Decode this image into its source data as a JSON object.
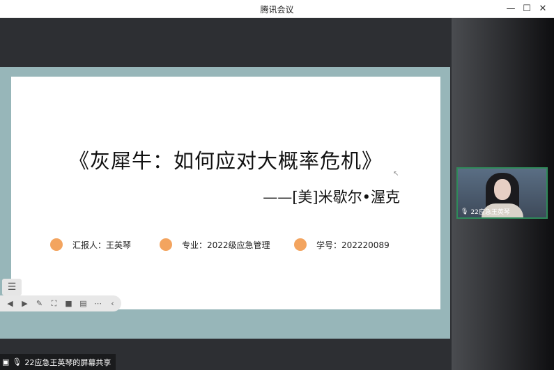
{
  "window": {
    "title": "腾讯会议",
    "minimize": "—",
    "maximize": "☐",
    "close": "✕"
  },
  "slide": {
    "title": "《灰犀牛：如何应对大概率危机》",
    "author": "——[美]米歇尔•渥克",
    "reporter": "汇报人：王英琴",
    "major": "专业：2022级应急管理",
    "student_id": "学号：202220089"
  },
  "toolbar": {
    "menu_icon": "list-icon",
    "icons": [
      "back-icon",
      "play-icon",
      "pen-icon",
      "screenshot-icon",
      "camera-icon",
      "chat-icon",
      "more-icon",
      "collapse-icon"
    ]
  },
  "participant": {
    "name": "22应急王英琴"
  },
  "status": {
    "text": "22应急王英琴的屏幕共享"
  },
  "colors": {
    "accent_dot": "#f3a45f",
    "share_frame": "#97b6b9",
    "active_speaker_border": "#2f8a5a"
  }
}
